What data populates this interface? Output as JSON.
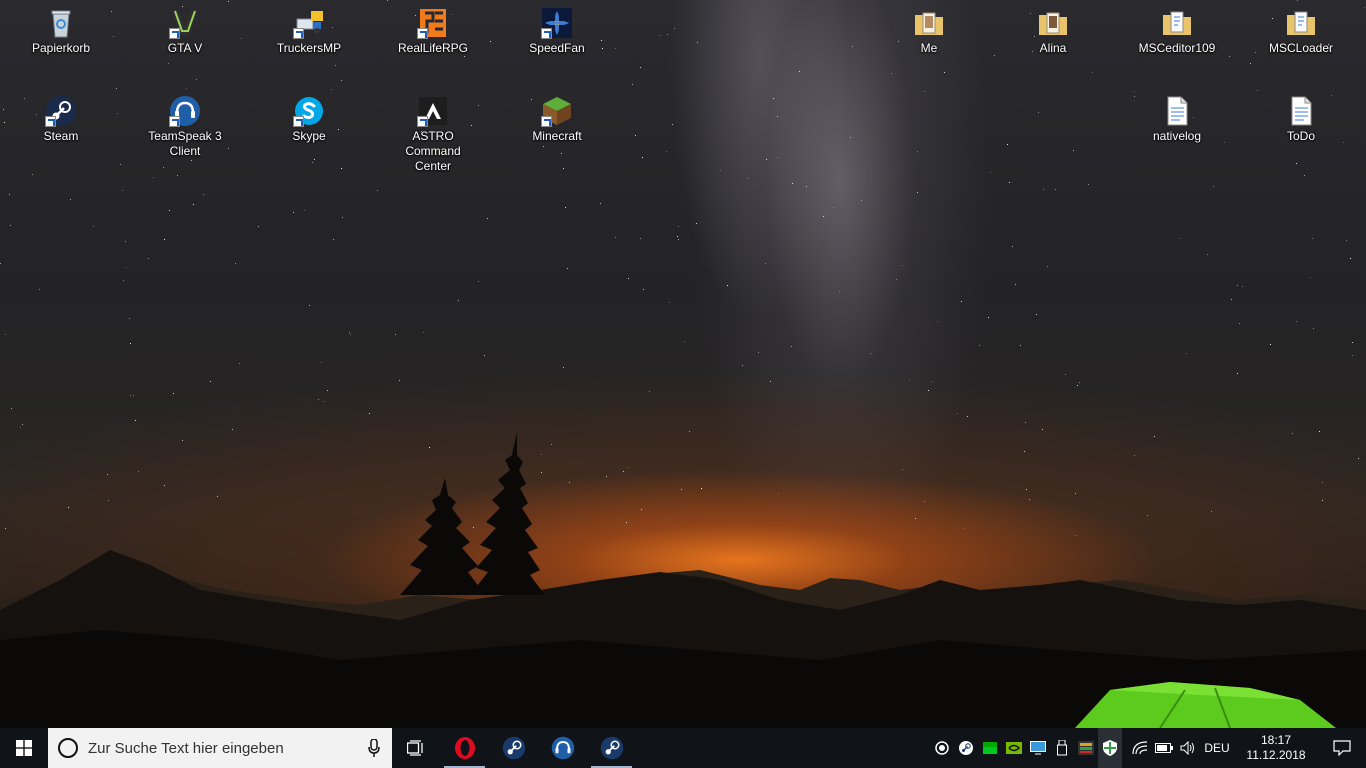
{
  "desktop": {
    "icons": [
      {
        "id": "papierkorb",
        "label": "Papierkorb",
        "icon": "recycle-bin-icon"
      },
      {
        "id": "gtav",
        "label": "GTA V",
        "icon": "gta-icon"
      },
      {
        "id": "truckersmp",
        "label": "TruckersMP",
        "icon": "truckersmp-icon"
      },
      {
        "id": "realliferpg",
        "label": "RealLifeRPG",
        "icon": "realliferpg-icon"
      },
      {
        "id": "speedfan",
        "label": "SpeedFan",
        "icon": "speedfan-icon"
      },
      {
        "id": "me",
        "label": "Me",
        "icon": "folder-icon"
      },
      {
        "id": "alina",
        "label": "Alina",
        "icon": "folder-icon"
      },
      {
        "id": "msceditor",
        "label": "MSCeditor109",
        "icon": "folder-icon"
      },
      {
        "id": "mscloader",
        "label": "MSCLoader",
        "icon": "folder-icon"
      },
      {
        "id": "steam",
        "label": "Steam",
        "icon": "steam-icon"
      },
      {
        "id": "teamspeak",
        "label": "TeamSpeak 3 Client",
        "icon": "teamspeak-icon"
      },
      {
        "id": "skype",
        "label": "Skype",
        "icon": "skype-icon"
      },
      {
        "id": "astro",
        "label": "ASTRO Command Center",
        "icon": "astro-icon"
      },
      {
        "id": "minecraft",
        "label": "Minecraft",
        "icon": "minecraft-icon"
      },
      {
        "id": "nativelog",
        "label": "nativelog",
        "icon": "text-file-icon"
      },
      {
        "id": "todo",
        "label": "ToDo",
        "icon": "text-file-icon"
      }
    ]
  },
  "taskbar": {
    "search_placeholder": "Zur Suche Text hier eingeben",
    "apps": [
      {
        "name": "opera",
        "icon": "opera-icon"
      },
      {
        "name": "steam",
        "icon": "steam-icon"
      },
      {
        "name": "teamspeak",
        "icon": "teamspeak-icon"
      },
      {
        "name": "steam-2",
        "icon": "steam-icon"
      }
    ],
    "tray": {
      "language": "DEU",
      "time": "18:17",
      "date": "11.12.2018"
    }
  },
  "colors": {
    "taskbar_bg": "#101318",
    "search_bg": "#f2f2f2",
    "accent": "#a6b7cf"
  }
}
